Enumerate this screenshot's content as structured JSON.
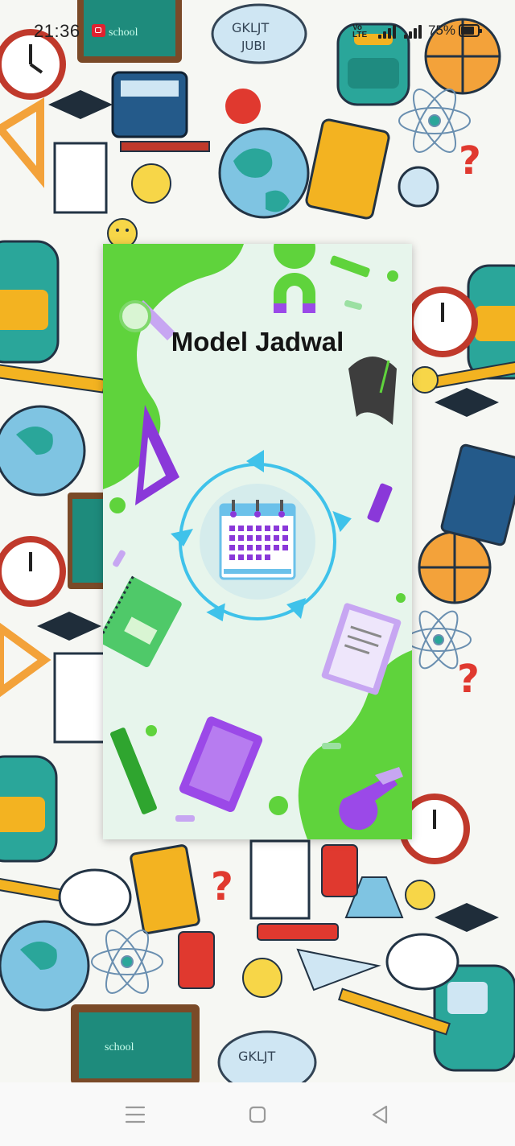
{
  "status_bar": {
    "time": "21:36",
    "volte_line1": "Vo",
    "volte_line2": "LTE",
    "battery_percent": "75%"
  },
  "splash": {
    "title": "Model Jadwal",
    "icon": "calendar-icon"
  },
  "nav_bar": {
    "menu_icon": "menu-icon",
    "home_icon": "home-icon",
    "back_icon": "back-icon"
  },
  "colors": {
    "card_background": "#e7f5ec",
    "green_blob": "#5fd33c",
    "purple": "#9b49e8",
    "cycle_blue": "#3fc2ea",
    "title_text": "#141414"
  }
}
